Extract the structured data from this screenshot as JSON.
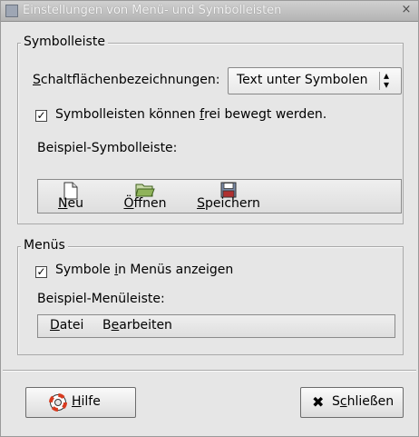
{
  "window": {
    "title": "Einstellungen von Menü- und Symbolleisten",
    "close_glyph": "×"
  },
  "toolbar_section": {
    "label": "Symbolleiste",
    "button_labels_caption": {
      "mnemonic": "S",
      "rest": "chaltflächenbezeichnungen:"
    },
    "button_labels_value": "Text unter Symbolen",
    "detachable": {
      "checked": true,
      "before": "Symbolleisten können ",
      "mnemonic": "f",
      "after": "rei bewegt werden."
    },
    "example_label": "Beispiel-Symbolleiste:",
    "buttons": [
      {
        "mnemonic": "N",
        "rest": "eu",
        "icon": "new-document-icon"
      },
      {
        "mnemonic": "Ö",
        "rest": "ffnen",
        "icon": "open-folder-icon"
      },
      {
        "mnemonic": "S",
        "rest": "peichern",
        "icon": "floppy-disk-icon"
      }
    ]
  },
  "menu_section": {
    "label": "Menüs",
    "show_icons": {
      "checked": true,
      "before": "Symbole ",
      "mnemonic": "i",
      "after": "n Menüs anzeigen"
    },
    "example_label": "Beispiel-Menüleiste:",
    "menus": [
      {
        "mnemonic": "D",
        "rest": "atei"
      },
      {
        "before": "B",
        "mnemonic": "e",
        "after": "arbeiten"
      }
    ]
  },
  "footer": {
    "help": {
      "mnemonic": "H",
      "rest": "ilfe",
      "icon": "lifebuoy-icon"
    },
    "close": {
      "before": "S",
      "mnemonic": "c",
      "after": "hließen",
      "icon": "close-x-icon",
      "icon_glyph": "✖"
    }
  },
  "colors": {
    "window_bg": "#e6e6e6",
    "folder_green": "#5a8a2c",
    "floppy_red": "#b03030",
    "lifebuoy_red": "#d83a1e"
  }
}
